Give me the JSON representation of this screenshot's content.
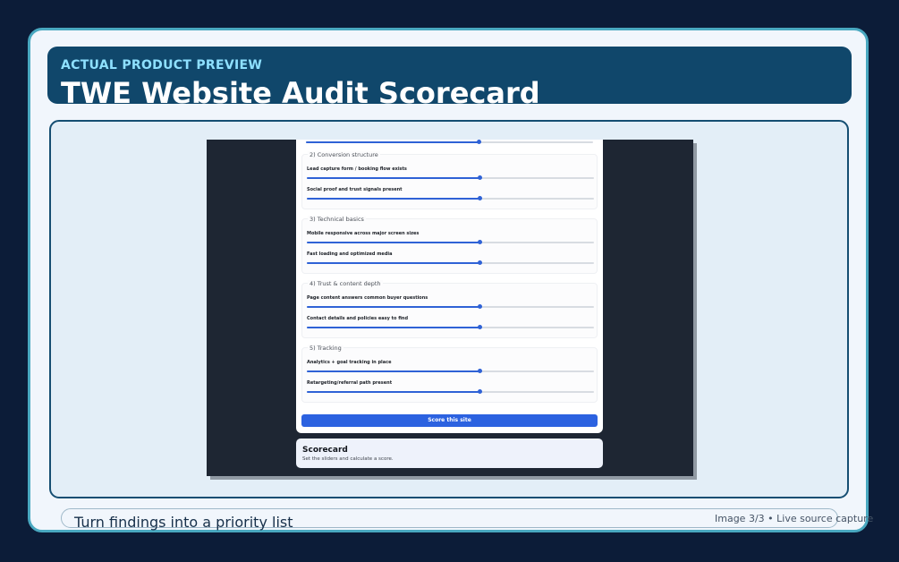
{
  "header": {
    "kicker": "ACTUAL PRODUCT PREVIEW",
    "title": "TWE Website Audit Scorecard"
  },
  "form": {
    "sections": [
      {
        "title": "2) Conversion structure",
        "fields": [
          {
            "label": "Lead capture form / booking flow exists",
            "value": 0.6
          },
          {
            "label": "Social proof and trust signals present",
            "value": 0.6
          }
        ]
      },
      {
        "title": "3) Technical basics",
        "fields": [
          {
            "label": "Mobile responsive across major screen sizes",
            "value": 0.6
          },
          {
            "label": "Fast loading and optimized media",
            "value": 0.6
          }
        ]
      },
      {
        "title": "4) Trust & content depth",
        "fields": [
          {
            "label": "Page content answers common buyer questions",
            "value": 0.6
          },
          {
            "label": "Contact details and policies easy to find",
            "value": 0.6
          }
        ]
      },
      {
        "title": "5) Tracking",
        "fields": [
          {
            "label": "Analytics + goal tracking in place",
            "value": 0.6
          },
          {
            "label": "Retargeting/referral path present",
            "value": 0.6
          }
        ]
      }
    ],
    "top_slider_value": 0.6,
    "submit_label": "Score this site"
  },
  "scorecard": {
    "title": "Scorecard",
    "subtitle": "Set the sliders and calculate a score."
  },
  "footer": {
    "caption": "Turn findings into a priority list",
    "meta": "Image 3/3 • Live source capture"
  },
  "colors": {
    "accent": "#2c62e0",
    "header_bg": "#10476b",
    "frame_border": "#49a8c0"
  }
}
